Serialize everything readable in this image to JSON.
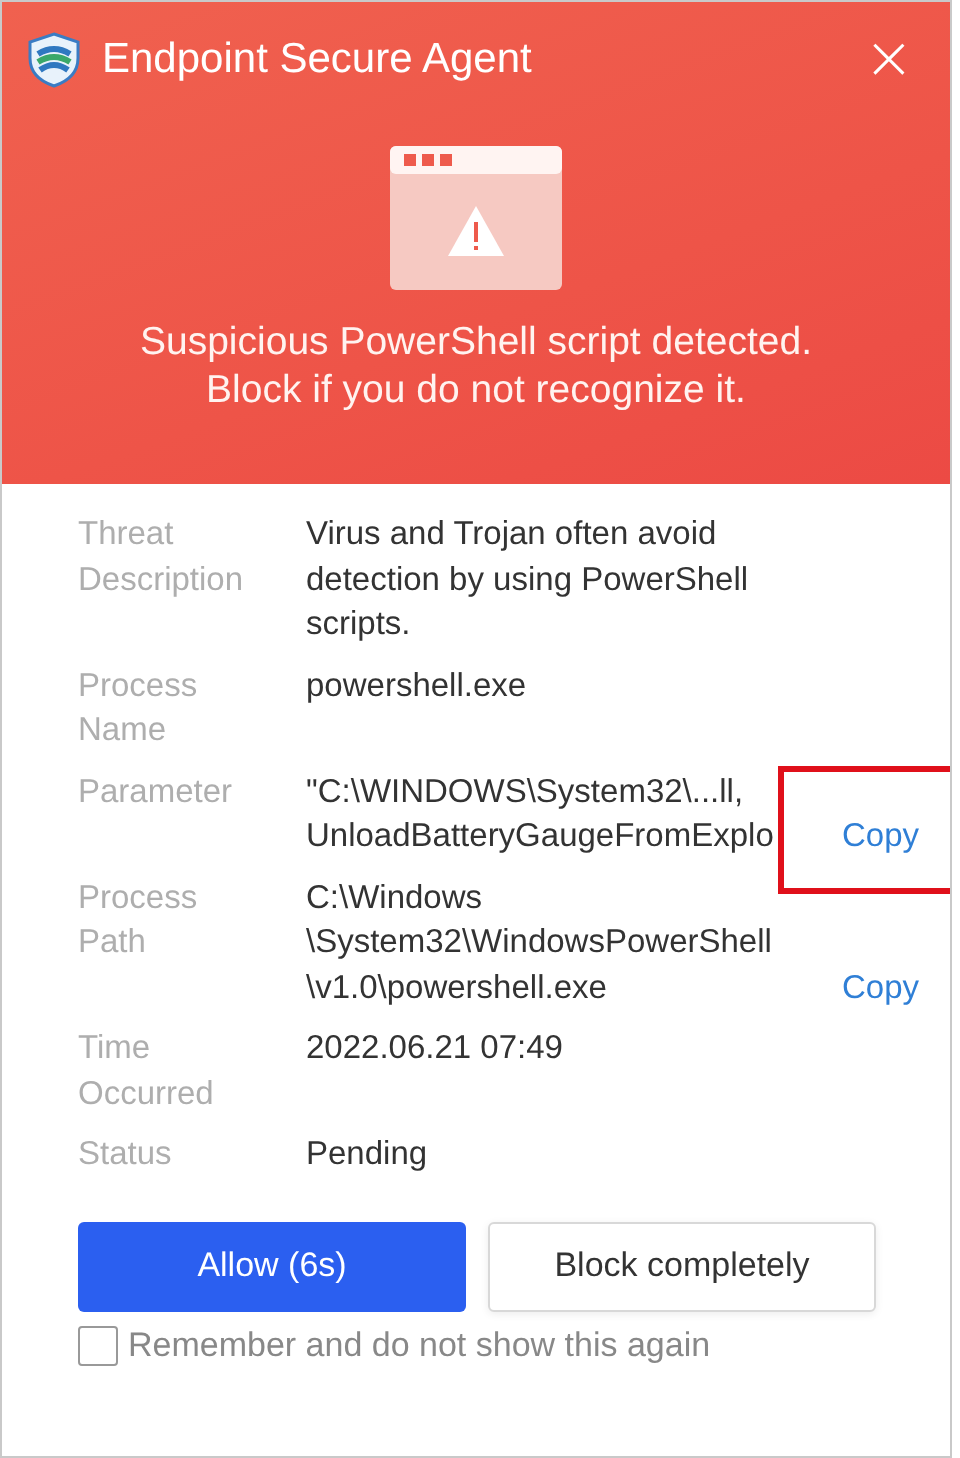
{
  "window": {
    "title": "Endpoint Secure Agent",
    "close": "×"
  },
  "alert": {
    "lines": [
      "Suspicious PowerShell script detected.",
      "Block if you do not recognize it."
    ]
  },
  "rows": [
    {
      "label": [
        "Threat",
        "Description"
      ],
      "lines": [
        "Virus and Trojan often avoid",
        "detection by using PowerShell",
        "scripts."
      ]
    },
    {
      "label": [
        "Process",
        "Name"
      ],
      "lines": [
        "powershell.exe"
      ]
    },
    {
      "label": [
        "Parameter"
      ],
      "lines": [
        "\"C:\\WINDOWS\\System32\\...ll,",
        "UnloadBatteryGaugeFromExplo"
      ],
      "copy": {
        "label": "Copy",
        "highlighted": true
      }
    },
    {
      "label": [
        "Process",
        "Path"
      ],
      "lines": [
        "C:\\Windows",
        "\\System32\\WindowsPowerShell",
        "\\v1.0\\powershell.exe"
      ],
      "copy": {
        "label": "Copy",
        "highlighted": false
      }
    },
    {
      "label": [
        "Time",
        "Occurred"
      ],
      "lines": [
        "2022.06.21 07:49"
      ]
    },
    {
      "label": [
        "Status"
      ],
      "lines": [
        "Pending"
      ]
    }
  ],
  "buttons": [
    {
      "label": "Allow (6s)",
      "kind": "primary"
    },
    {
      "label": "Block completely",
      "kind": "secondary"
    }
  ],
  "remember": {
    "label": "Remember and do not show this again",
    "checked": false
  }
}
